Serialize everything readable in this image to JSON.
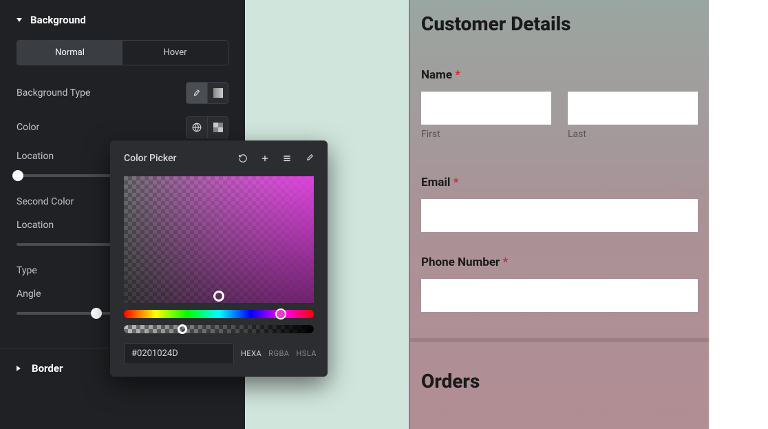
{
  "sidebar": {
    "sections": {
      "background": {
        "title": "Background",
        "tabs": {
          "normal": "Normal",
          "hover": "Hover"
        },
        "backgroundType": "Background Type",
        "colorLabel": "Color",
        "location1": "Location",
        "secondColor": "Second Color",
        "location2": "Location",
        "type": "Type",
        "angle": "Angle"
      },
      "border": {
        "title": "Border"
      }
    }
  },
  "picker": {
    "title": "Color Picker",
    "hex": "#0201024D",
    "formats": {
      "hexa": "HEXA",
      "rgba": "RGBA",
      "hsla": "HSLA"
    }
  },
  "form": {
    "heading": "Customer Details",
    "name": {
      "label": "Name",
      "first": "First",
      "last": "Last"
    },
    "email": "Email",
    "phone": "Phone Number",
    "orders": "Orders"
  }
}
